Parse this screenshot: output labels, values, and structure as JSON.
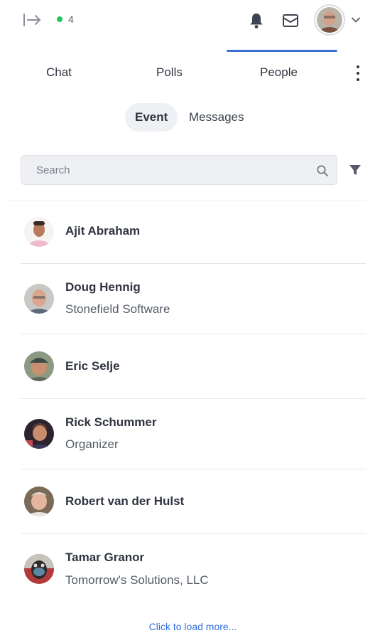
{
  "topbar": {
    "online_count": "4",
    "online_color": "#22c55e"
  },
  "tabs": [
    {
      "label": "Chat",
      "active": false
    },
    {
      "label": "Polls",
      "active": false
    },
    {
      "label": "People",
      "active": true
    }
  ],
  "accent_color": "#3b6fd6",
  "segments": [
    {
      "label": "Event",
      "selected": true
    },
    {
      "label": "Messages",
      "selected": false
    }
  ],
  "search": {
    "placeholder": "Search",
    "value": ""
  },
  "people": [
    {
      "name": "Ajit Abraham",
      "subtitle": ""
    },
    {
      "name": "Doug Hennig",
      "subtitle": "Stonefield Software"
    },
    {
      "name": "Eric Selje",
      "subtitle": ""
    },
    {
      "name": "Rick Schummer",
      "subtitle": "Organizer"
    },
    {
      "name": "Robert van der Hulst",
      "subtitle": ""
    },
    {
      "name": "Tamar Granor",
      "subtitle": "Tomorrow's Solutions, LLC"
    }
  ],
  "load_more_label": "Click to load more..."
}
